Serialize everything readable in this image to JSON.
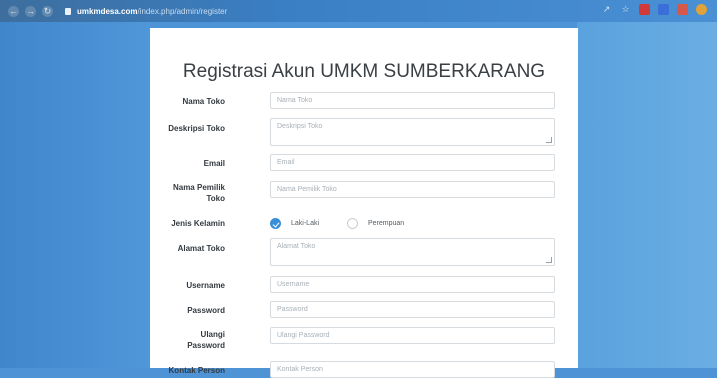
{
  "browser": {
    "domain": "umkmdesa.com",
    "path": "/index.php/admin/register"
  },
  "form": {
    "title": "Registrasi Akun UMKM SUMBERKARANG",
    "fields": [
      {
        "label": "Nama Toko",
        "placeholder": "Nama Toko"
      },
      {
        "label": "Deskripsi Toko",
        "placeholder": "Deskripsi Toko"
      },
      {
        "label": "Email",
        "placeholder": "Email"
      },
      {
        "label": "Nama Pemilik Toko",
        "placeholder": "Nama Pemilik Toko"
      },
      {
        "label": "Jenis Kelamin"
      },
      {
        "label": "Alamat Toko",
        "placeholder": "Alamat Toko"
      },
      {
        "label": "Username",
        "placeholder": "Username"
      },
      {
        "label": "Password",
        "placeholder": "Password"
      },
      {
        "label": "Ulangi Password",
        "placeholder": "Ulangi Password"
      },
      {
        "label": "Kontak Person",
        "placeholder": "Kontak Person"
      }
    ],
    "gender_options": [
      "Laki-Laki",
      "Perempuan"
    ],
    "gender_selected": "Laki-Laki"
  },
  "colors": {
    "accent": "#3a8fd8",
    "background": "#4d93d6"
  }
}
